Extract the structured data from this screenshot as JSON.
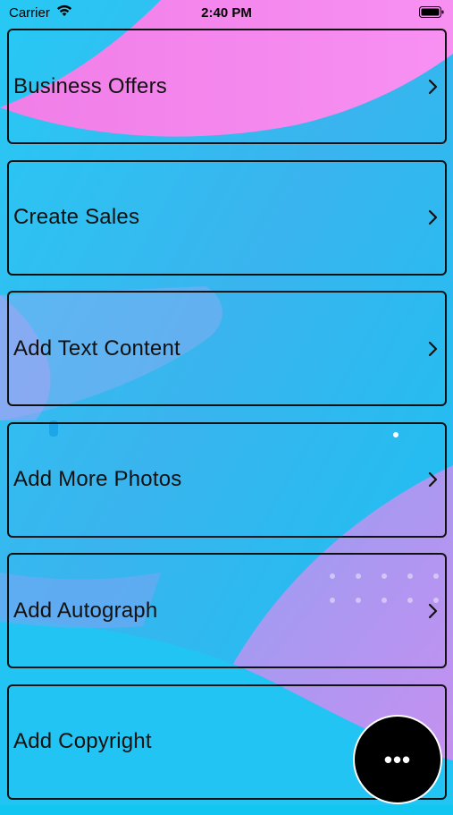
{
  "status_bar": {
    "carrier": "Carrier",
    "time": "2:40 PM"
  },
  "menu": {
    "items": [
      {
        "label": "Business Offers"
      },
      {
        "label": "Create Sales"
      },
      {
        "label": "Add Text Content"
      },
      {
        "label": "Add More Photos"
      },
      {
        "label": "Add Autograph"
      },
      {
        "label": "Add Copyright"
      }
    ]
  },
  "fab": {
    "label": "•••",
    "icon": "more-horizontal-icon"
  },
  "colors": {
    "background_cyan": "#12c6f2",
    "background_pink": "#f48af0",
    "background_violet": "#b38df2",
    "border": "#111111",
    "fab": "#000000"
  }
}
